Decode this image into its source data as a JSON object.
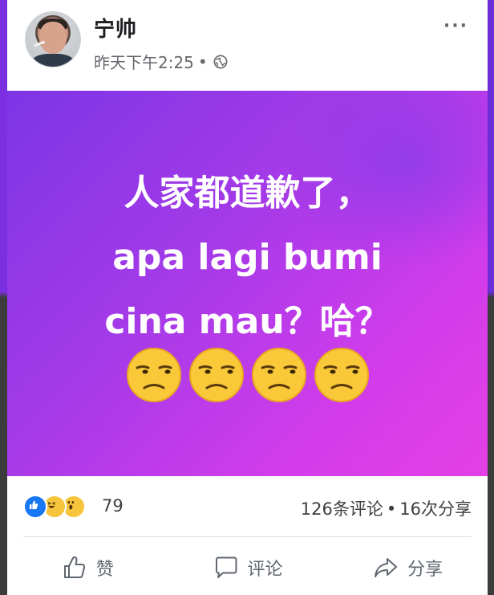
{
  "post": {
    "author": "宁帅",
    "timestamp": "昨天下午2:25",
    "separator": "•",
    "privacy_icon": "globe-icon",
    "more_label": "···",
    "content": {
      "line1": "人家都道歉了，",
      "line2": "apa lagi bumi",
      "line3": "cina mau？哈？",
      "emojis": [
        "unamused-face",
        "unamused-face",
        "unamused-face",
        "unamused-face"
      ],
      "background_colors": [
        "#7d35e6",
        "#e340e6"
      ]
    },
    "reactions": {
      "types": [
        "like",
        "haha",
        "wow"
      ],
      "count": "79"
    },
    "engagement": {
      "comments": "126条评论",
      "dot": "•",
      "shares": "16次分享"
    },
    "actions": {
      "like_label": "赞",
      "comment_label": "评论",
      "share_label": "分享"
    }
  }
}
